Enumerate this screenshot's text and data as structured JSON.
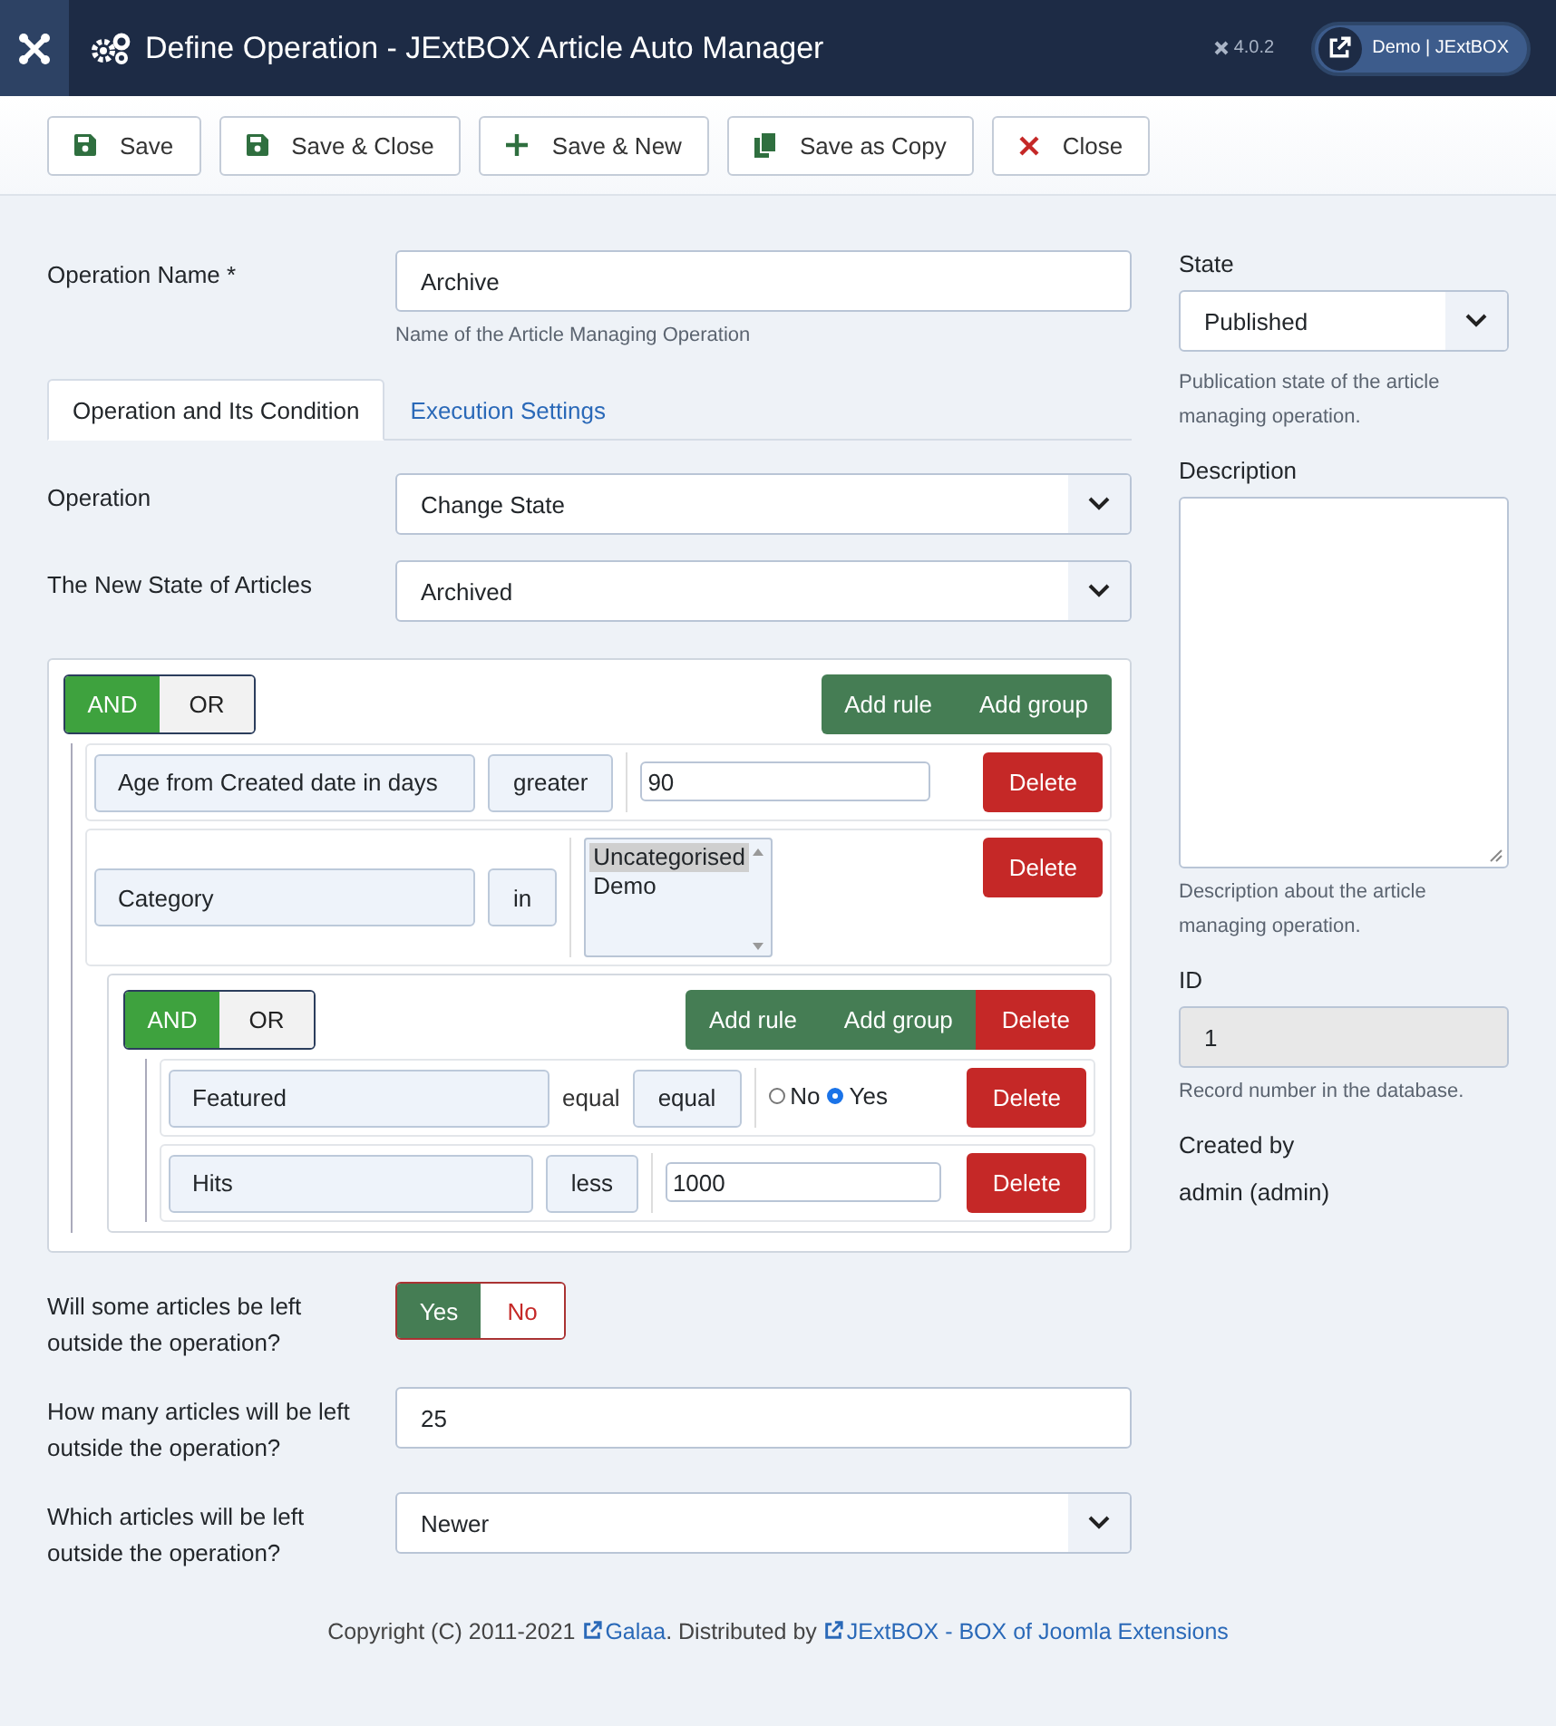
{
  "header": {
    "title": "Define Operation - JExtBOX Article Auto Manager",
    "version": "4.0.2",
    "user_button": "Demo | JExtBOX"
  },
  "toolbar": [
    {
      "label": "Save",
      "kind": "save"
    },
    {
      "label": "Save & Close",
      "kind": "save"
    },
    {
      "label": "Save & New",
      "kind": "new"
    },
    {
      "label": "Save as Copy",
      "kind": "copy"
    },
    {
      "label": "Close",
      "kind": "close"
    }
  ],
  "name_field": {
    "label": "Operation Name *",
    "value": "Archive",
    "hint": "Name of the Article Managing Operation"
  },
  "tabs": [
    {
      "label": "Operation and Its Condition",
      "selected": true
    },
    {
      "label": "Execution Settings",
      "selected": false
    }
  ],
  "selects": [
    {
      "label": "Operation",
      "value": "Change State"
    },
    {
      "label": "The New State of Articles",
      "value": "Archived"
    }
  ],
  "query": {
    "conditions": [
      {
        "label": "AND",
        "selected": true
      },
      {
        "label": "OR",
        "selected": false
      }
    ],
    "actions": [
      "Add rule",
      "Add group"
    ],
    "items": [
      {
        "kind": "value",
        "field": "Age from Created date in days",
        "operator": "greater",
        "value": "90",
        "delete": "Delete"
      },
      {
        "kind": "list",
        "field": "Category",
        "operator": "in",
        "options": [
          {
            "label": "Uncategorised",
            "selected": true
          },
          {
            "label": "Demo",
            "selected": false
          }
        ],
        "delete": "Delete"
      },
      {
        "kind": "group",
        "conditions": [
          {
            "label": "AND",
            "selected": true
          },
          {
            "label": "OR",
            "selected": false
          }
        ],
        "actions": [
          "Add rule",
          "Add group"
        ],
        "delete": "Delete",
        "items": [
          {
            "kind": "radio",
            "field": "Featured",
            "operator_text": "equal",
            "operator": "equal",
            "options": [
              {
                "label": "No",
                "selected": false
              },
              {
                "label": "Yes",
                "selected": true
              }
            ],
            "delete": "Delete"
          },
          {
            "kind": "value",
            "field": "Hits",
            "operator": "less",
            "value": "1000",
            "delete": "Delete"
          }
        ]
      }
    ]
  },
  "leftover": {
    "label": "Will some articles be left outside the operation?",
    "options": [
      {
        "label": "Yes",
        "selected": true
      },
      {
        "label": "No",
        "selected": false
      }
    ]
  },
  "count_field": {
    "label": "How many articles will be left outside the operation?",
    "value": "25"
  },
  "which_field": {
    "label": "Which articles will be left outside the operation?",
    "value": "Newer"
  },
  "sidebar": {
    "state": {
      "label": "State",
      "value": "Published",
      "hint": "Publication state of the article managing operation."
    },
    "description": {
      "label": "Description",
      "hint": "Description about the article managing operation."
    },
    "id": {
      "label": "ID",
      "value": "1",
      "hint": "Record number in the database."
    },
    "created_by": {
      "label": "Created by",
      "value": "admin (admin)"
    }
  },
  "footer": [
    {
      "kind": "text",
      "text": "Copyright (C) 2011-2021 "
    },
    {
      "kind": "link",
      "text": "Galaa"
    },
    {
      "kind": "text",
      "text": ". Distributed by "
    },
    {
      "kind": "link",
      "text": "JExtBOX - BOX of Joomla Extensions"
    }
  ]
}
